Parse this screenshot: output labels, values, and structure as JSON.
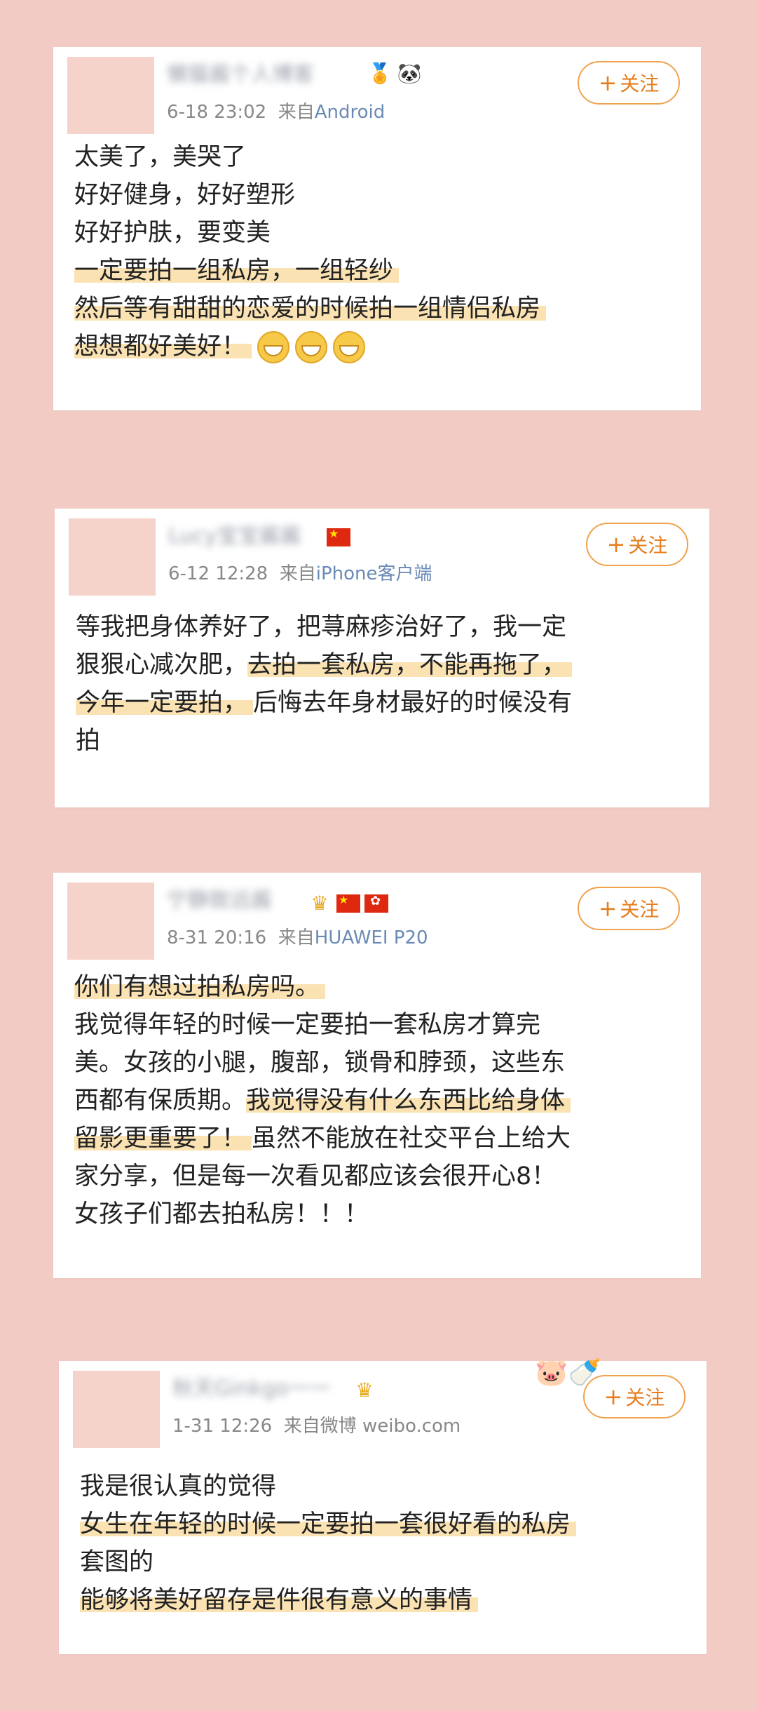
{
  "posts": [
    {
      "name": "懒猫酱个人博客",
      "badges": [
        "🏅",
        "🐼"
      ],
      "date": "6-18 23:02",
      "from_prefix": "来自",
      "source": "Android",
      "follow": "关注",
      "lines": [
        "太美了，美哭了",
        "好好健身，好好塑形",
        "好好护肤，要变美",
        "一定要拍一组私房，一组轻纱",
        "然后等有甜甜的恋爱的时候拍一组情侣私房",
        "想想都好美好！"
      ]
    },
    {
      "name": "Lucy宝宝酱酱",
      "date": "6-12 12:28",
      "from_prefix": "来自",
      "source": "iPhone客户端",
      "follow": "关注",
      "lines": [
        "等我把身体养好了，把荨麻疹治好了，我一定",
        "狠狠心减次肥，",
        "去拍一套私房，不能再拖了，",
        "今年一定要拍，",
        "后悔去年身材最好的时候没有",
        "拍"
      ]
    },
    {
      "name": "宁静致远酱",
      "badges": [
        "♛"
      ],
      "date": "8-31 20:16",
      "from_prefix": "来自",
      "source": "HUAWEI P20",
      "follow": "关注",
      "lines": [
        "你们有想过拍私房吗。",
        "我觉得年轻的时候一定要拍一套私房才算完",
        "美。女孩的小腿，腹部，锁骨和脖颈，这些东",
        "西都有保质期。",
        "我觉得没有什么东西比给身体",
        "留影更重要了！",
        "虽然不能放在社交平台上给大",
        "家分享，但是每一次看见都应该会很开心8！",
        "女孩子们都去拍私房！！！"
      ]
    },
    {
      "name": "秋天Ginkgo一一",
      "badges": [
        "♛"
      ],
      "date": "1-31 12:26",
      "from_prefix": "来自微博",
      "source": "weibo.com",
      "follow": "关注",
      "deco": [
        "🐷",
        "🍼"
      ],
      "lines": [
        "我是很认真的觉得",
        "女生在年轻的时候一定要拍一套很好看的私房",
        "套图的",
        "能够将美好留存是件很有意义的事情"
      ]
    }
  ]
}
